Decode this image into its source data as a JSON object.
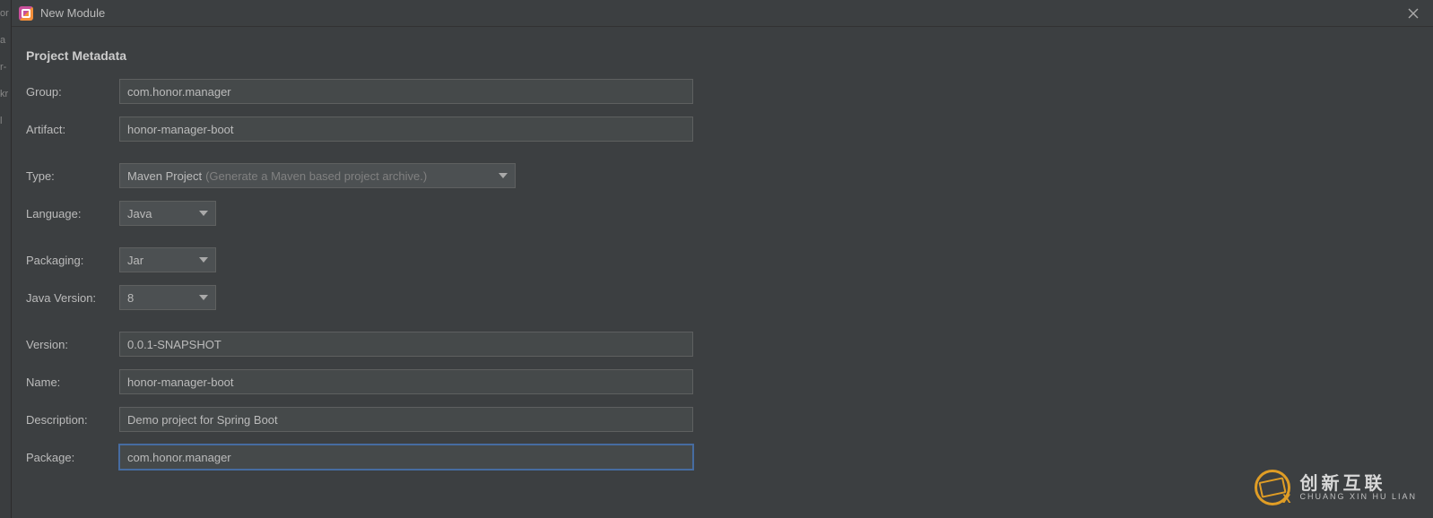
{
  "left_sliver": [
    "or",
    "a",
    "",
    "r-",
    "kr",
    "l"
  ],
  "titlebar": {
    "title": "New Module"
  },
  "section_title": "Project Metadata",
  "labels": {
    "group": "Group:",
    "artifact": "Artifact:",
    "type": "Type:",
    "language": "Language:",
    "packaging": "Packaging:",
    "java_version": "Java Version:",
    "version": "Version:",
    "name": "Name:",
    "description": "Description:",
    "package": "Package:"
  },
  "values": {
    "group": "com.honor.manager",
    "artifact": "honor-manager-boot",
    "type_main": "Maven Project",
    "type_hint": "(Generate a Maven based project archive.)",
    "language": "Java",
    "packaging": "Jar",
    "java_version": "8",
    "version": "0.0.1-SNAPSHOT",
    "name": "honor-manager-boot",
    "description": "Demo project for Spring Boot",
    "package": "com.honor.manager"
  },
  "watermark": {
    "cn": "创新互联",
    "en": "CHUANG XIN HU LIAN"
  }
}
